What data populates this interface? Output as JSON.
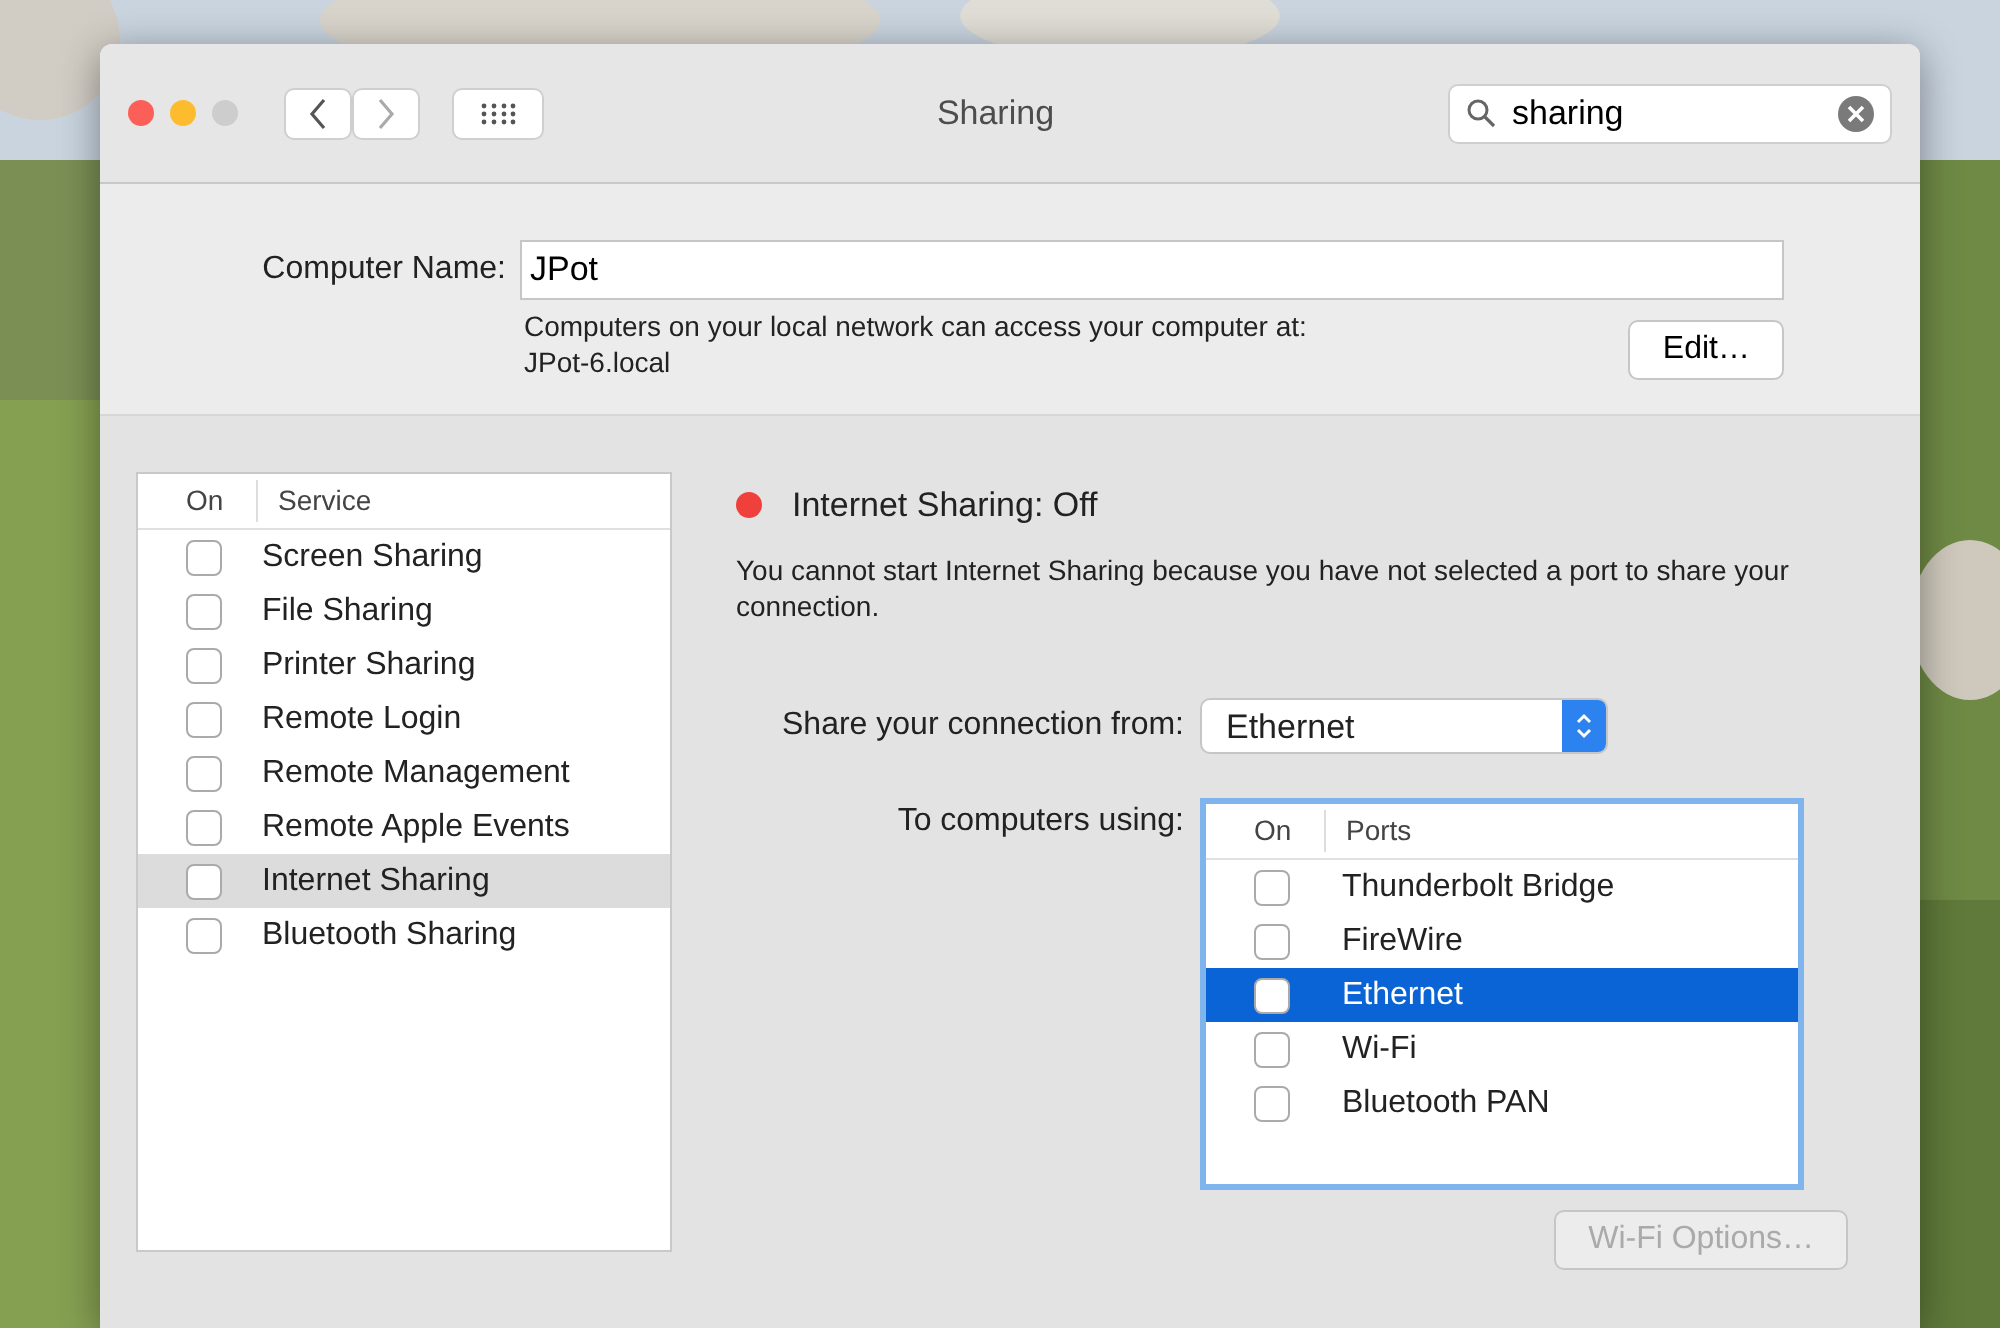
{
  "window": {
    "title": "Sharing"
  },
  "search": {
    "value": "sharing"
  },
  "computer_name": {
    "label": "Computer Name:",
    "value": "JPot",
    "note": "Computers on your local network can access your computer at:",
    "address": "JPot-6.local",
    "edit_button": "Edit…"
  },
  "services": {
    "columns": [
      "On",
      "Service"
    ],
    "items": [
      {
        "name": "Screen Sharing",
        "checked": false,
        "selected": false
      },
      {
        "name": "File Sharing",
        "checked": false,
        "selected": false
      },
      {
        "name": "Printer Sharing",
        "checked": false,
        "selected": false
      },
      {
        "name": "Remote Login",
        "checked": false,
        "selected": false
      },
      {
        "name": "Remote Management",
        "checked": false,
        "selected": false
      },
      {
        "name": "Remote Apple Events",
        "checked": false,
        "selected": false
      },
      {
        "name": "Internet Sharing",
        "checked": false,
        "selected": true
      },
      {
        "name": "Bluetooth Sharing",
        "checked": false,
        "selected": false
      }
    ]
  },
  "status": {
    "label": "Internet Sharing: Off",
    "on": false
  },
  "message": "You cannot start Internet Sharing because you have not selected a port to share your connection.",
  "share_from": {
    "label": "Share your connection from:",
    "value": "Ethernet"
  },
  "to_computers": {
    "label": "To computers using:",
    "columns": [
      "On",
      "Ports"
    ],
    "ports": [
      {
        "name": "Thunderbolt Bridge",
        "checked": false,
        "selected": false
      },
      {
        "name": "FireWire",
        "checked": false,
        "selected": false
      },
      {
        "name": "Ethernet",
        "checked": false,
        "selected": true
      },
      {
        "name": "Wi-Fi",
        "checked": false,
        "selected": false
      },
      {
        "name": "Bluetooth PAN",
        "checked": false,
        "selected": false
      }
    ]
  },
  "wifi_options": {
    "label": "Wi-Fi Options…",
    "disabled": true
  }
}
